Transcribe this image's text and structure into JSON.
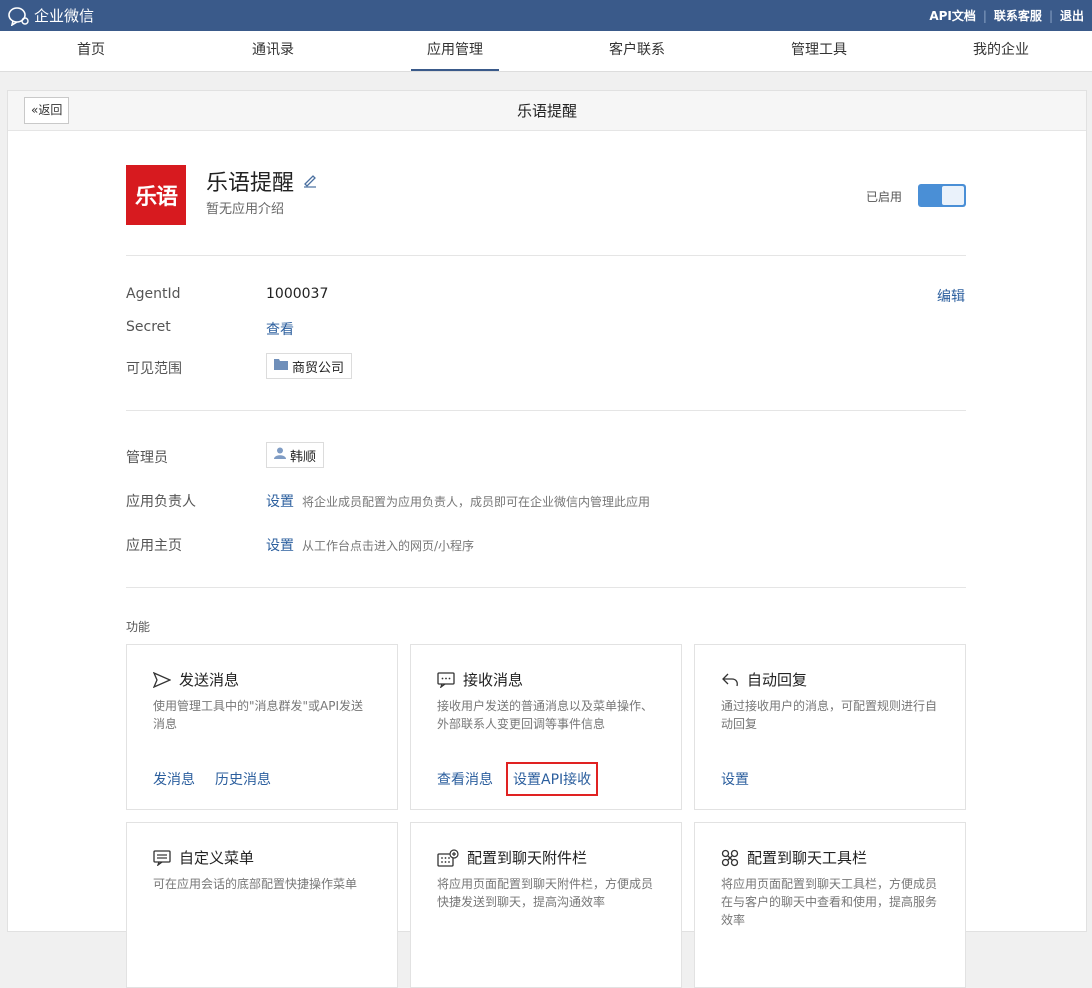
{
  "topbar": {
    "brand": "企业微信",
    "links": [
      "API文档",
      "联系客服",
      "退出"
    ]
  },
  "nav": {
    "tabs": [
      "首页",
      "通讯录",
      "应用管理",
      "客户联系",
      "管理工具",
      "我的企业"
    ],
    "active_index": 2
  },
  "panel": {
    "back_label": "返回",
    "title": "乐语提醒"
  },
  "app": {
    "icon_text": "乐语",
    "name": "乐语提醒",
    "description": "暂无应用介绍",
    "status_label": "已启用",
    "enabled": true
  },
  "details": {
    "agentid_label": "AgentId",
    "agentid_value": "1000037",
    "edit_label": "编辑",
    "secret_label": "Secret",
    "secret_action": "查看",
    "scope_label": "可见范围",
    "scope_value": "商贸公司"
  },
  "admin": {
    "admin_label": "管理员",
    "admin_value": "韩顺",
    "owner_label": "应用负责人",
    "owner_action": "设置",
    "owner_hint": "将企业成员配置为应用负责人，成员即可在企业微信内管理此应用",
    "home_label": "应用主页",
    "home_action": "设置",
    "home_hint": "从工作台点击进入的网页/小程序"
  },
  "features": {
    "section_title": "功能",
    "cards": [
      {
        "icon": "send-icon",
        "title": "发送消息",
        "desc": "使用管理工具中的\"消息群发\"或API发送消息",
        "actions": [
          "发消息",
          "历史消息"
        ]
      },
      {
        "icon": "message-icon",
        "title": "接收消息",
        "desc": "接收用户发送的普通消息以及菜单操作、外部联系人变更回调等事件信息",
        "actions": [
          "查看消息",
          "设置API接收"
        ],
        "highlighted_action": 1
      },
      {
        "icon": "reply-icon",
        "title": "自动回复",
        "desc": "通过接收用户的消息，可配置规则进行自动回复",
        "actions": [
          "设置"
        ]
      },
      {
        "icon": "menu-icon",
        "title": "自定义菜单",
        "desc": "可在应用会话的底部配置快捷操作菜单",
        "actions": []
      },
      {
        "icon": "attachment-icon",
        "title": "配置到聊天附件栏",
        "desc": "将应用页面配置到聊天附件栏，方便成员快捷发送到聊天，提高沟通效率",
        "actions": []
      },
      {
        "icon": "toolbar-icon",
        "title": "配置到聊天工具栏",
        "desc": "将应用页面配置到聊天工具栏，方便成员在与客户的聊天中查看和使用，提高服务效率",
        "actions": []
      }
    ]
  }
}
